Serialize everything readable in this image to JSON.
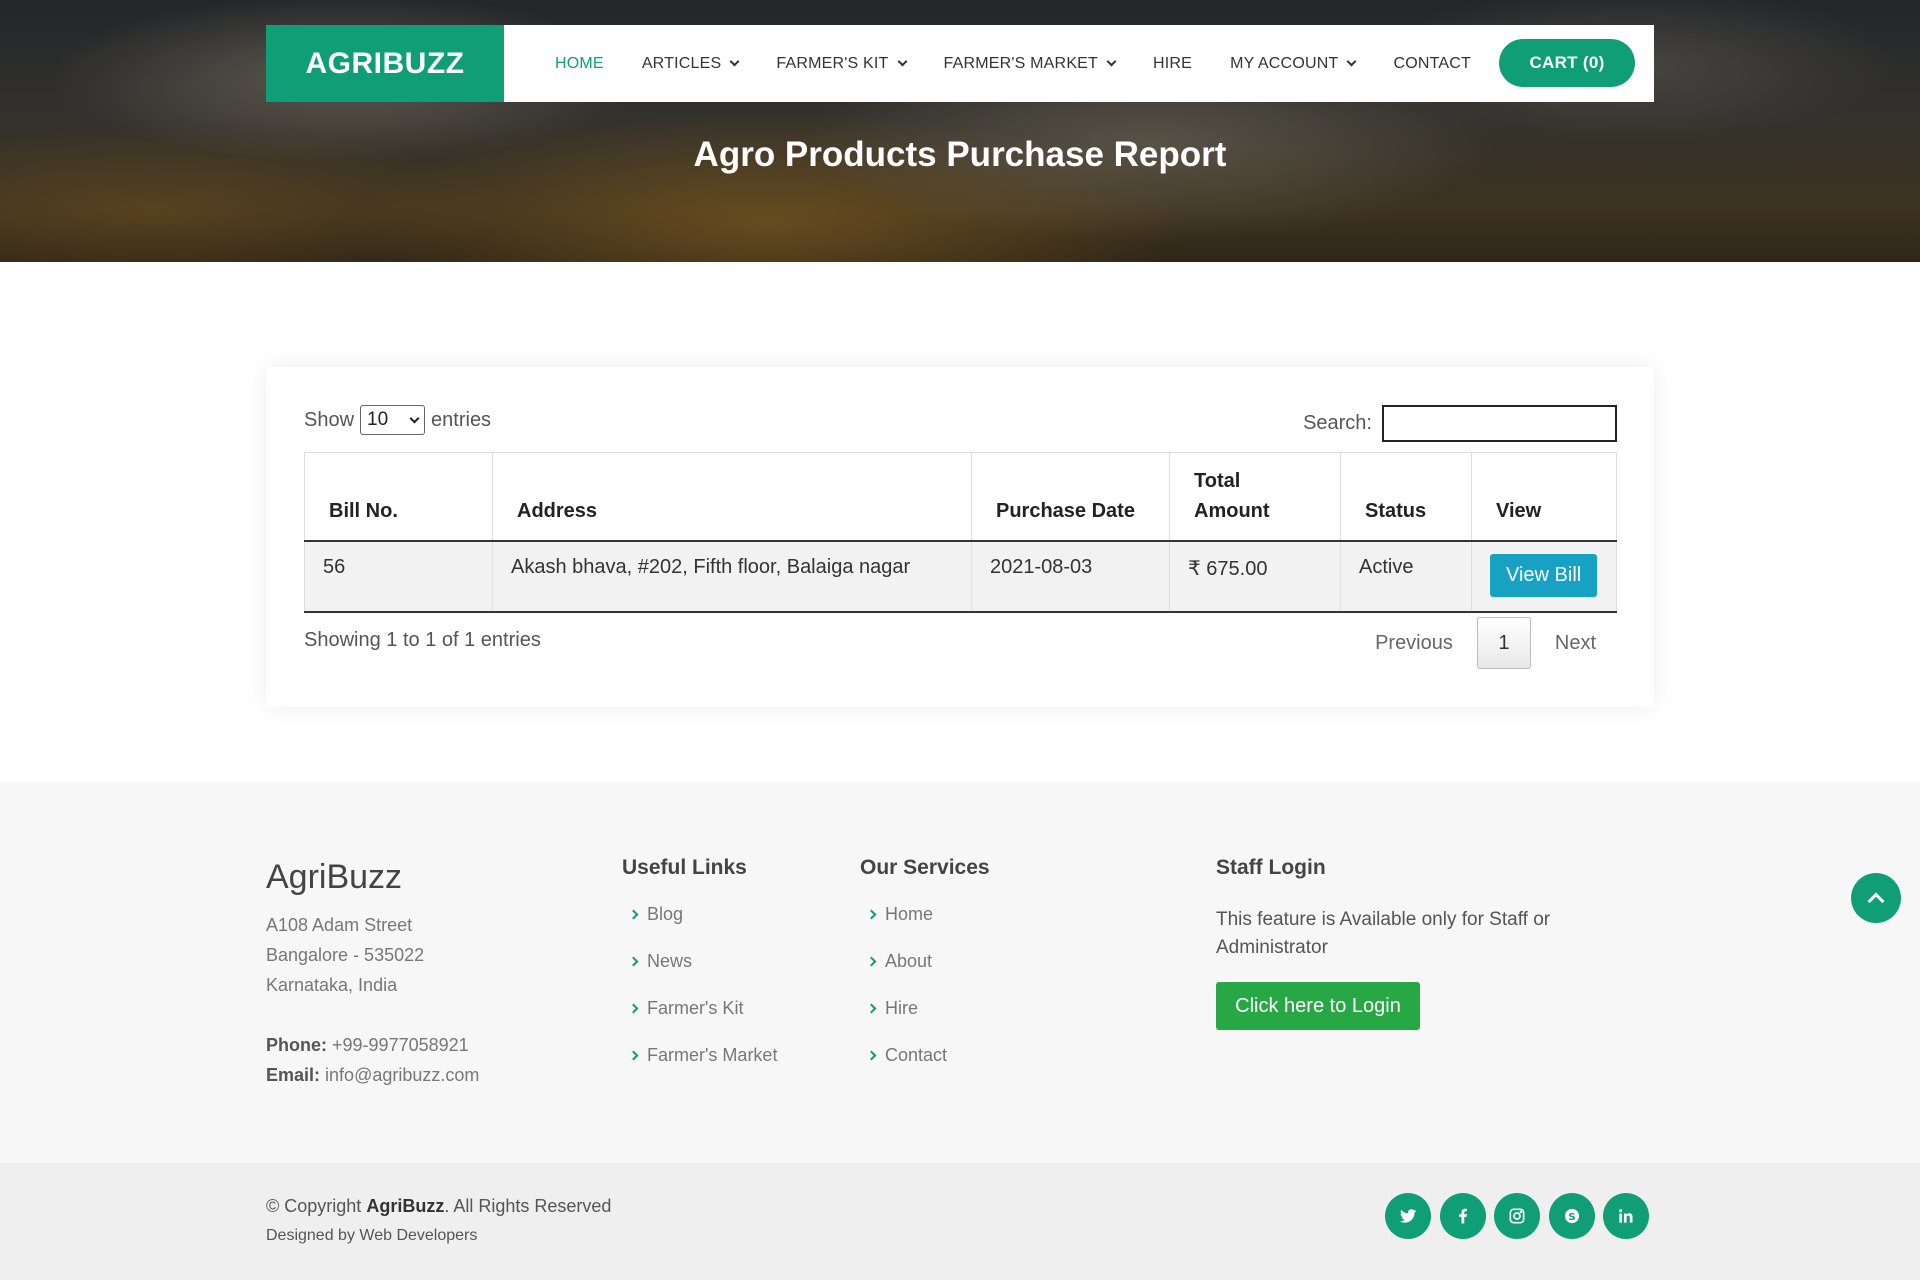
{
  "brand": "AGRIBUZZ",
  "nav": {
    "items": [
      {
        "label": "HOME",
        "has_dropdown": false,
        "active": true
      },
      {
        "label": "ARTICLES",
        "has_dropdown": true
      },
      {
        "label": "FARMER'S KIT",
        "has_dropdown": true
      },
      {
        "label": "FARMER'S MARKET",
        "has_dropdown": true
      },
      {
        "label": "HIRE",
        "has_dropdown": false
      },
      {
        "label": "MY ACCOUNT",
        "has_dropdown": true
      },
      {
        "label": "CONTACT",
        "has_dropdown": false
      }
    ],
    "cart_label": "CART (0)"
  },
  "page_title": "Agro Products Purchase Report",
  "table_controls": {
    "show_label": "Show",
    "entries_value": "10",
    "entries_label": "entries",
    "search_label": "Search:",
    "search_value": ""
  },
  "table": {
    "headers": [
      "Bill No.",
      "Address",
      "Purchase Date",
      "Total Amount",
      "Status",
      "View"
    ],
    "rows": [
      {
        "bill_no": "56",
        "address": "Akash bhava, #202, Fifth floor, Balaiga nagar",
        "purchase_date": "2021-08-03",
        "total_amount": "₹ 675.00",
        "status": "Active",
        "view_label": "View Bill"
      }
    ]
  },
  "pagination": {
    "info": "Showing 1 to 1 of 1 entries",
    "previous": "Previous",
    "current_page": "1",
    "next": "Next"
  },
  "footer": {
    "brand": "AgriBuzz",
    "address_lines": [
      "A108 Adam Street",
      "Bangalore - 535022",
      "Karnataka, India"
    ],
    "phone_label": "Phone:",
    "phone": "+99-9977058921",
    "email_label": "Email:",
    "email": "info@agribuzz.com",
    "useful_links_title": "Useful Links",
    "useful_links": [
      "Blog",
      "News",
      "Farmer's Kit",
      "Farmer's Market"
    ],
    "services_title": "Our Services",
    "services": [
      "Home",
      "About",
      "Hire",
      "Contact"
    ],
    "staff_title": "Staff Login",
    "staff_text": "This feature is Available only for Staff or Administrator",
    "login_label": "Click here to Login"
  },
  "bottom": {
    "copyright_prefix": "© Copyright",
    "copyright_brand": "AgriBuzz",
    "copyright_suffix": ". All Rights Reserved",
    "designed_by": "Designed by Web Developers",
    "socials": [
      "twitter-icon",
      "facebook-icon",
      "instagram-icon",
      "skype-icon",
      "linkedin-icon"
    ]
  },
  "colors": {
    "accent": "#0f9e75",
    "view_button": "#17a2c4",
    "login_button": "#28a745"
  }
}
